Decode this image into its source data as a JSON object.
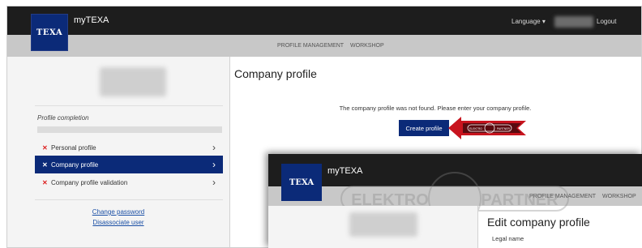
{
  "topbar": {
    "logo": "TEXA",
    "app_title": "myTEXA",
    "language": "Language ▾",
    "logout": "Logout"
  },
  "subnav": {
    "items": [
      "PROFILE MANAGEMENT",
      "WORKSHOP"
    ]
  },
  "sidebar": {
    "profile_completion": "Profile completion",
    "menu": [
      {
        "label": "Personal profile",
        "status": "✕",
        "active": false
      },
      {
        "label": "Company profile",
        "status": "✕",
        "active": true
      },
      {
        "label": "Company profile validation",
        "status": "✕",
        "active": false
      }
    ],
    "links": [
      "Change password",
      "Disassociate user"
    ],
    "chevron": "›"
  },
  "main": {
    "title": "Company profile",
    "message": "The company profile was not found. Please enter your company profile.",
    "create_button": "Create profile",
    "arrow_logo": {
      "left": "ELEKTRO",
      "right": "PARTNER"
    }
  },
  "overlay": {
    "logo": "TEXA",
    "app_title": "myTEXA",
    "subnav": [
      "PROFILE MANAGEMENT",
      "WORKSHOP"
    ],
    "title": "Edit company profile",
    "field_label": "Legal name",
    "watermark": {
      "left": "ELEKTRO",
      "right": "PARTNER"
    }
  },
  "colors": {
    "brand_blue": "#0b2a78",
    "topbar": "#1d1d1d",
    "subnav": "#c8c8c8",
    "error_red": "#dd2222",
    "arrow_red": "#c8141e"
  }
}
